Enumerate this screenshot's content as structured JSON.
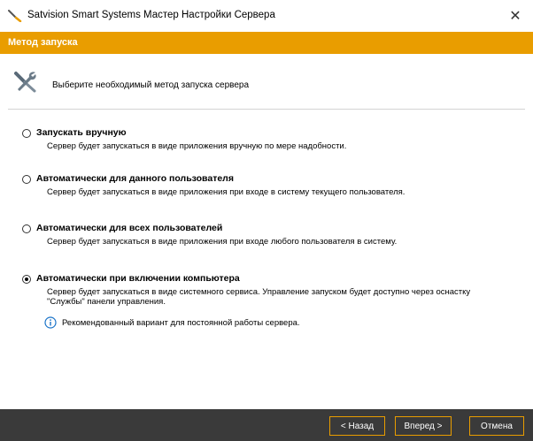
{
  "window": {
    "title": "Satvision Smart Systems Мастер Настройки Сервера",
    "close_glyph": "✕"
  },
  "header": {
    "label": "Метод запуска"
  },
  "intro": {
    "text": "Выберите необходимый метод запуска сервера",
    "icon": "tools-icon"
  },
  "options": [
    {
      "title": "Запускать вручную",
      "description": "Сервер будет запускаться в виде приложения вручную по мере надобности.",
      "selected": false
    },
    {
      "title": "Автоматически для данного пользователя",
      "description": "Сервер будет запускаться в виде приложения при входе  в систему текущего пользователя.",
      "selected": false
    },
    {
      "title": "Автоматически для всех пользователей",
      "description": "Сервер будет запускаться в виде приложения при входе любого пользователя в систему.",
      "selected": false
    },
    {
      "title": "Автоматически при включении компьютера",
      "description_line1": "Сервер будет запускаться в виде системного сервиса. Управление запуском будет доступно через оснастку",
      "description_line2": "\"Службы\" панели управления.",
      "selected": true
    }
  ],
  "info": {
    "text": "Рекомендованный вариант для постоянной работы сервера."
  },
  "footer": {
    "back_label": "< Назад",
    "next_label": "Вперед >",
    "cancel_label": "Отмена"
  },
  "colors": {
    "accent": "#e99d00",
    "footer_bg": "#3a3a3a",
    "info_blue": "#1a73c8"
  }
}
